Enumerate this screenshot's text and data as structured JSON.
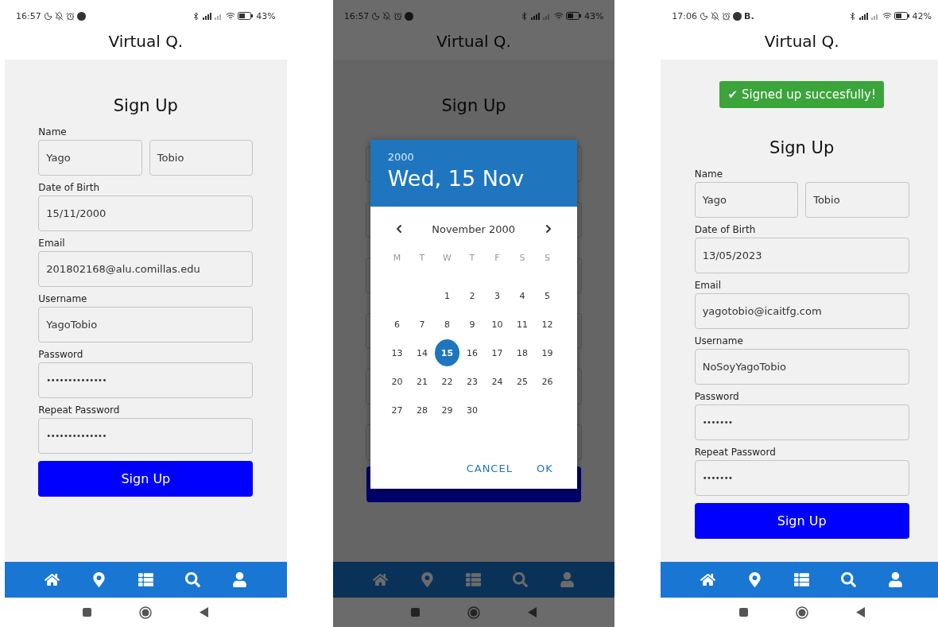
{
  "phones": [
    {
      "status": {
        "time": "16:57",
        "battery": "43%"
      },
      "app_title": "Virtual Q.",
      "dimmed": false,
      "form": {
        "heading": "Sign Up",
        "fields": [
          {
            "label": "Name",
            "kind": "text",
            "values": [
              "Yago",
              "Tobio"
            ]
          },
          {
            "label": "Date of Birth",
            "kind": "text",
            "values": [
              "15/11/2000"
            ]
          },
          {
            "label": "Email",
            "kind": "text",
            "values": [
              "201802168@alu.comillas.edu"
            ]
          },
          {
            "label": "Username",
            "kind": "text",
            "values": [
              "YagoTobio"
            ]
          },
          {
            "label": "Password",
            "kind": "password",
            "values": [
              "••••••••••••••"
            ]
          },
          {
            "label": "Repeat Password",
            "kind": "password",
            "values": [
              "••••••••••••••"
            ]
          }
        ],
        "button": "Sign Up"
      }
    },
    {
      "status": {
        "time": "16:57",
        "battery": "43%"
      },
      "app_title": "Virtual Q.",
      "dimmed": true,
      "form": {
        "heading": "Sign Up"
      },
      "dialog": {
        "year": "2000",
        "date": "Wed, 15 Nov",
        "month": "November 2000",
        "weekdays": [
          "M",
          "T",
          "W",
          "T",
          "F",
          "S",
          "S"
        ],
        "weeks": [
          {
            "kind": "leading",
            "days": [
              {
                "label": "1",
                "selected": false
              },
              {
                "label": "2",
                "selected": false
              },
              {
                "label": "3",
                "selected": false
              },
              {
                "label": "4",
                "selected": false
              },
              {
                "label": "5",
                "selected": false
              }
            ]
          },
          {
            "kind": "full",
            "days": [
              {
                "label": "6",
                "selected": false
              },
              {
                "label": "7",
                "selected": false
              },
              {
                "label": "8",
                "selected": false
              },
              {
                "label": "9",
                "selected": false
              },
              {
                "label": "10",
                "selected": false
              },
              {
                "label": "11",
                "selected": false
              },
              {
                "label": "12",
                "selected": false
              }
            ]
          },
          {
            "kind": "full",
            "days": [
              {
                "label": "13",
                "selected": false
              },
              {
                "label": "14",
                "selected": false
              },
              {
                "label": "15",
                "selected": true
              },
              {
                "label": "16",
                "selected": false
              },
              {
                "label": "17",
                "selected": false
              },
              {
                "label": "18",
                "selected": false
              },
              {
                "label": "19",
                "selected": false
              }
            ]
          },
          {
            "kind": "full",
            "days": [
              {
                "label": "20",
                "selected": false
              },
              {
                "label": "21",
                "selected": false
              },
              {
                "label": "22",
                "selected": false
              },
              {
                "label": "23",
                "selected": false
              },
              {
                "label": "24",
                "selected": false
              },
              {
                "label": "25",
                "selected": false
              },
              {
                "label": "26",
                "selected": false
              }
            ]
          },
          {
            "kind": "trailing",
            "days": [
              {
                "label": "27",
                "selected": false
              },
              {
                "label": "28",
                "selected": false
              },
              {
                "label": "29",
                "selected": false
              },
              {
                "label": "30",
                "selected": false
              }
            ]
          }
        ],
        "buttons": [
          "CANCEL",
          "OK"
        ]
      }
    },
    {
      "status": {
        "time": "17:06",
        "notification": "B.",
        "battery": "42%"
      },
      "app_title": "Virtual Q.",
      "dimmed": false,
      "toast": {
        "icon": "✔",
        "text": "Signed up succesfully!"
      },
      "form": {
        "heading": "Sign Up",
        "fields": [
          {
            "label": "Name",
            "kind": "text",
            "values": [
              "Yago",
              "Tobio"
            ]
          },
          {
            "label": "Date of Birth",
            "kind": "text",
            "values": [
              "13/05/2023"
            ]
          },
          {
            "label": "Email",
            "kind": "text",
            "values": [
              "yagotobio@icaitfg.com"
            ]
          },
          {
            "label": "Username",
            "kind": "text",
            "values": [
              "NoSoyYagoTobio"
            ]
          },
          {
            "label": "Password",
            "kind": "password",
            "values": [
              "•••••••"
            ]
          },
          {
            "label": "Repeat Password",
            "kind": "password",
            "values": [
              "•••••••"
            ]
          }
        ],
        "button": "Sign Up"
      }
    }
  ]
}
